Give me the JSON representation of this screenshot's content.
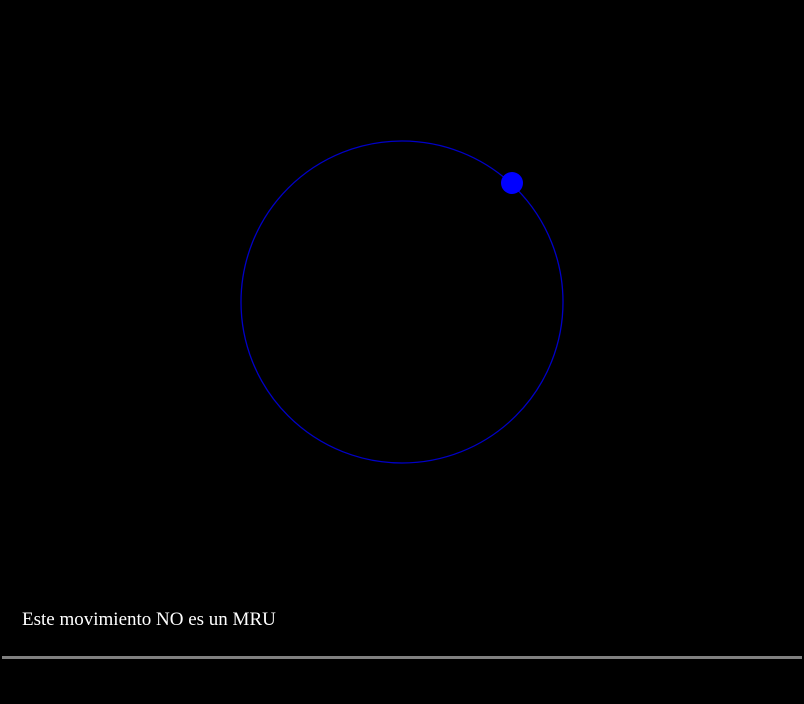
{
  "animation": {
    "message": "Este movimiento NO es un MRU",
    "orbit_color": "#0000c8",
    "ball_color": "#0000ff",
    "background_color": "#000000",
    "divider_color": "#808080",
    "text_color": "#ffffff"
  }
}
